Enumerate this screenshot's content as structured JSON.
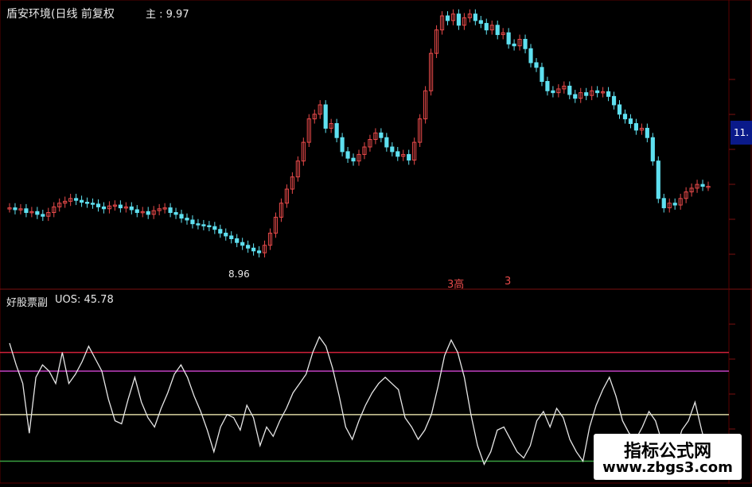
{
  "header": {
    "title": "盾安环境(日线 前复权",
    "main_label": "主 : 9.97"
  },
  "price_tag": "11.",
  "low_label": "8.96",
  "sub": {
    "title": "好股票副",
    "indicator": "UOS: 45.78"
  },
  "red_marks": [
    "3高",
    "3"
  ],
  "watermark": {
    "line1": "指标公式网",
    "line2": "www.zbgs3.com"
  },
  "colors": {
    "background": "#000000",
    "up_candle": "#e84a4a",
    "down_candle": "#5fe0f0",
    "uos_line": "#e6e6e6",
    "level_red": "#d0203a",
    "level_magenta": "#c040c0",
    "level_beige": "#d8d4a0",
    "level_green": "#3aa040"
  },
  "chart_data": [
    {
      "type": "candlestick",
      "title": "盾安环境(日线 前复权",
      "ylim": [
        8.7,
        11.5
      ],
      "close": [
        9.45,
        9.43,
        9.44,
        9.4,
        9.41,
        9.38,
        9.36,
        9.4,
        9.46,
        9.5,
        9.52,
        9.55,
        9.53,
        9.51,
        9.5,
        9.49,
        9.46,
        9.44,
        9.47,
        9.48,
        9.45,
        9.46,
        9.43,
        9.4,
        9.41,
        9.38,
        9.42,
        9.44,
        9.45,
        9.4,
        9.38,
        9.34,
        9.32,
        9.28,
        9.27,
        9.26,
        9.25,
        9.22,
        9.18,
        9.15,
        9.12,
        9.08,
        9.05,
        9.02,
        8.99,
        8.97,
        9.05,
        9.18,
        9.35,
        9.5,
        9.65,
        9.78,
        9.95,
        10.15,
        10.4,
        10.45,
        10.55,
        10.3,
        10.35,
        10.2,
        10.05,
        9.98,
        9.95,
        10.02,
        10.1,
        10.18,
        10.25,
        10.2,
        10.1,
        10.05,
        10.0,
        10.02,
        9.96,
        10.15,
        10.4,
        10.7,
        11.1,
        11.35,
        11.5,
        11.45,
        11.52,
        11.4,
        11.48,
        11.52,
        11.45,
        11.42,
        11.35,
        11.4,
        11.3,
        11.32,
        11.2,
        11.18,
        11.25,
        11.15,
        11.0,
        10.95,
        10.8,
        10.7,
        10.68,
        10.72,
        10.75,
        10.66,
        10.62,
        10.68,
        10.65,
        10.7,
        10.68,
        10.69,
        10.64,
        10.55,
        10.45,
        10.4,
        10.35,
        10.28,
        10.3,
        10.2,
        9.95,
        9.55,
        9.45,
        9.5,
        9.48,
        9.55,
        9.62,
        9.66,
        9.7,
        9.68,
        9.68
      ]
    },
    {
      "type": "line",
      "title": "好股票副",
      "series": [
        {
          "name": "UOS",
          "values": [
            83,
            76,
            70,
            54,
            72,
            76,
            74,
            70,
            80,
            70,
            73,
            77,
            82,
            78,
            74,
            65,
            58,
            57,
            65,
            72,
            64,
            59,
            56,
            62,
            67,
            73,
            76,
            72,
            66,
            61,
            55,
            48,
            56,
            60,
            59,
            55,
            63,
            59,
            50,
            56,
            53,
            58,
            62,
            67,
            70,
            73,
            80,
            85,
            82,
            75,
            66,
            56,
            52,
            58,
            63,
            67,
            70,
            72,
            70,
            68,
            59,
            56,
            52,
            55,
            60,
            69,
            79,
            84,
            80,
            72,
            60,
            50,
            44,
            48,
            55,
            56,
            52,
            48,
            46,
            50,
            58,
            61,
            56,
            62,
            59,
            52,
            48,
            45,
            56,
            63,
            68,
            72,
            66,
            58,
            54,
            52,
            56,
            61,
            58,
            51,
            44,
            48,
            55,
            58,
            64,
            55,
            47
          ]
        }
      ],
      "ylim": [
        40,
        95
      ],
      "levels": [
        80,
        74,
        60,
        45
      ]
    }
  ]
}
